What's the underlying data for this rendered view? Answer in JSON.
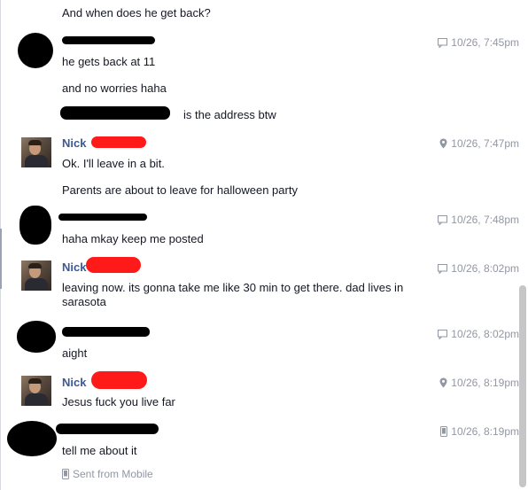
{
  "messages": [
    {
      "text": "And when does he get back?"
    },
    {
      "text": "he gets back at 11"
    },
    {
      "text": "and no worries haha"
    },
    {
      "text": "is the address btw"
    },
    {
      "text": "Ok. I'll leave in a bit."
    },
    {
      "text": "Parents are about to leave for halloween party"
    },
    {
      "text": "haha mkay keep me posted"
    },
    {
      "text": "leaving now. its gonna take me like 30 min to get there. dad lives in sarasota"
    },
    {
      "text": "aight"
    },
    {
      "text": "Jesus fuck you live far"
    },
    {
      "text": "tell me about it"
    }
  ],
  "senders": {
    "nick": "Nick"
  },
  "timestamps": [
    {
      "time": "10/26, 7:45pm",
      "icon": "chat-icon"
    },
    {
      "time": "10/26, 7:47pm",
      "icon": "location-pin-icon"
    },
    {
      "time": "10/26, 7:48pm",
      "icon": "chat-icon"
    },
    {
      "time": "10/26, 8:02pm",
      "icon": "chat-icon"
    },
    {
      "time": "10/26, 8:02pm",
      "icon": "chat-icon"
    },
    {
      "time": "10/26, 8:19pm",
      "icon": "location-pin-icon"
    },
    {
      "time": "10/26, 8:19pm",
      "icon": "mobile-phone-icon"
    }
  ],
  "footer": {
    "sent_from": "Sent from Mobile",
    "icon": "mobile-phone-icon"
  },
  "colors": {
    "sender_name": "#3b5998",
    "timestamp": "#9197a3",
    "text": "#141823",
    "redaction_red": "#ff1a1a"
  }
}
